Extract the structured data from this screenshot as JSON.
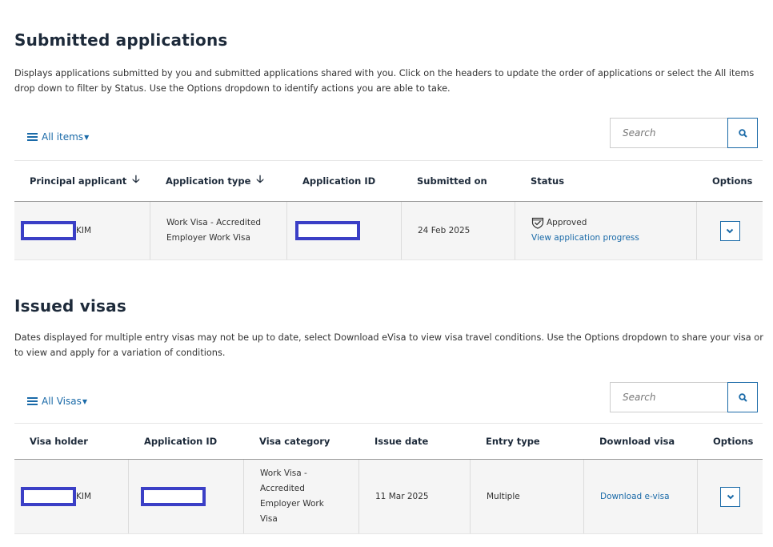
{
  "submitted": {
    "title": "Submitted applications",
    "description": "Displays applications submitted by you and submitted applications shared with you. Click on the headers to update the order of applications or select the All items drop down to filter by Status. Use the Options dropdown to identify actions you are able to take.",
    "filter_label": "All items",
    "search_placeholder": "Search",
    "columns": [
      "Principal applicant",
      "Application type",
      "Application ID",
      "Submitted on",
      "Status",
      "Options"
    ],
    "rows": [
      {
        "applicant_suffix": "KIM",
        "application_type": "Work Visa - Accredited Employer Work Visa",
        "submitted_on": "24 Feb 2025",
        "status": "Approved",
        "status_link": "View application progress"
      }
    ]
  },
  "issued": {
    "title": "Issued visas",
    "description": "Dates displayed for multiple entry visas may not be up to date, select Download eVisa to view visa travel conditions. Use the Options dropdown to share your visa or to view and apply for a variation of conditions.",
    "filter_label": "All Visas",
    "search_placeholder": "Search",
    "columns": [
      "Visa holder",
      "Application ID",
      "Visa category",
      "Issue date",
      "Entry type",
      "Download visa",
      "Options"
    ],
    "rows": [
      {
        "holder_suffix": "KIM",
        "visa_category": "Work Visa - Accredited Employer Work Visa",
        "issue_date": "11 Mar 2025",
        "entry_type": "Multiple",
        "download_link": "Download e-visa"
      }
    ]
  },
  "colors": {
    "link": "#1a6aa8",
    "redaction": "#3b3fc6",
    "row_bg": "#f5f5f5"
  },
  "icons": {
    "filter": "list-icon",
    "search": "search-icon",
    "options": "chevron-down-icon",
    "status": "shield-check-icon",
    "sort": "arrow-down-icon"
  }
}
